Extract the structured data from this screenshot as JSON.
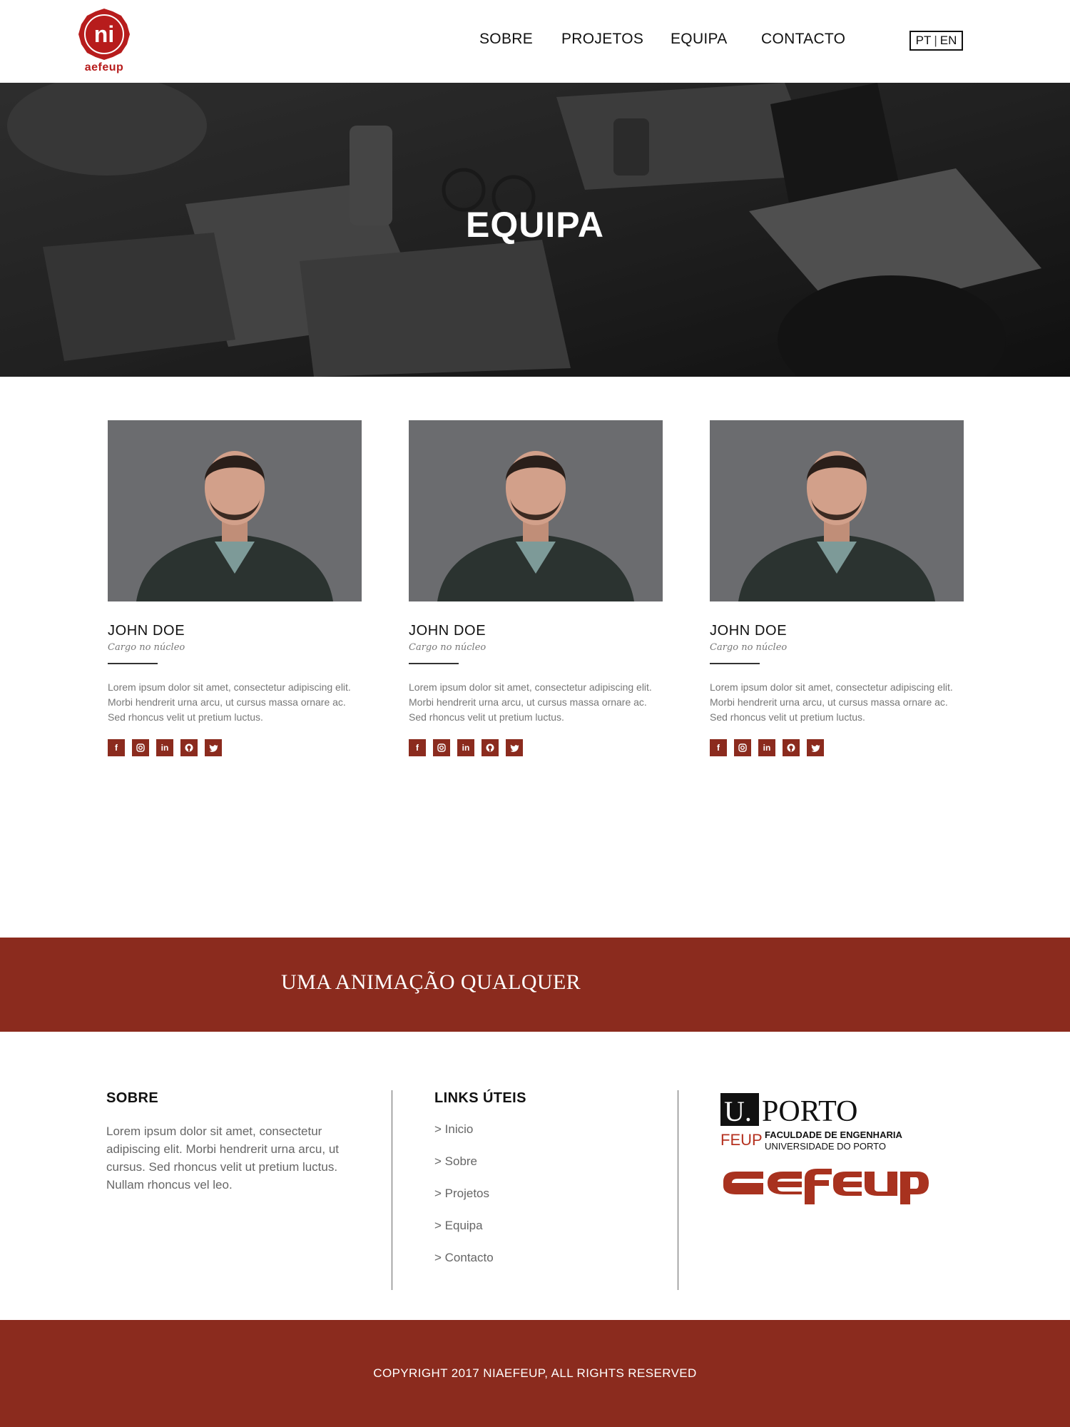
{
  "header": {
    "logo_mark": "ni",
    "logo_text": "aefeup",
    "nav": {
      "sobre": "SOBRE",
      "projetos": "PROJETOS",
      "equipa": "EQUIPA",
      "contacto": "CONTACTO"
    },
    "lang": {
      "pt": "PT",
      "separator": "|",
      "en": "EN"
    }
  },
  "hero": {
    "title": "EQUIPA"
  },
  "team": {
    "members": [
      {
        "name": "JOHN DOE",
        "role": "Cargo no núcleo",
        "bio": "Lorem ipsum dolor sit amet, consectetur adipiscing elit. Morbi hendrerit urna arcu, ut cursus massa ornare ac. Sed rhoncus velit ut pretium luctus.",
        "social": [
          "facebook-icon",
          "instagram-icon",
          "linkedin-icon",
          "github-icon",
          "twitter-icon"
        ]
      },
      {
        "name": "JOHN DOE",
        "role": "Cargo no núcleo",
        "bio": "Lorem ipsum dolor sit amet, consectetur adipiscing elit. Morbi hendrerit urna arcu, ut cursus massa ornare ac. Sed rhoncus velit ut pretium luctus.",
        "social": [
          "facebook-icon",
          "instagram-icon",
          "linkedin-icon",
          "github-icon",
          "twitter-icon"
        ]
      },
      {
        "name": "JOHN DOE",
        "role": "Cargo no núcleo",
        "bio": "Lorem ipsum dolor sit amet, consectetur adipiscing elit. Morbi hendrerit urna arcu, ut cursus massa ornare ac. Sed rhoncus velit ut pretium luctus.",
        "social": [
          "facebook-icon",
          "instagram-icon",
          "linkedin-icon",
          "github-icon",
          "twitter-icon"
        ]
      }
    ]
  },
  "banner": {
    "text": "UMA ANIMAÇÃO QUALQUER"
  },
  "footer": {
    "about": {
      "heading": "SOBRE",
      "text": "Lorem ipsum dolor sit amet, consectetur adipiscing elit. Morbi hendrerit urna arcu, ut cursus. Sed rhoncus velit ut pretium luctus. Nullam rhoncus vel leo."
    },
    "links": {
      "heading": "LINKS ÚTEIS",
      "items": [
        "> Inicio",
        "> Sobre",
        "> Projetos",
        "> Equipa",
        "> Contacto"
      ]
    },
    "partners": {
      "uporto_u": "U.",
      "uporto_porto": "PORTO",
      "feup_mark": "FEUP",
      "feup_line1": "FACULDADE DE ENGENHARIA",
      "feup_line2": "UNIVERSIDADE DO PORTO",
      "aefeup_logo": "aefeup"
    }
  },
  "copyright": {
    "text": "COPYRIGHT 2017 NIAEFEUP, ALL RIGHTS RESERVED"
  },
  "colors": {
    "brand": "#8b2b1e",
    "logo_red": "#b71c1c",
    "text": "#111111",
    "muted": "#777777"
  }
}
